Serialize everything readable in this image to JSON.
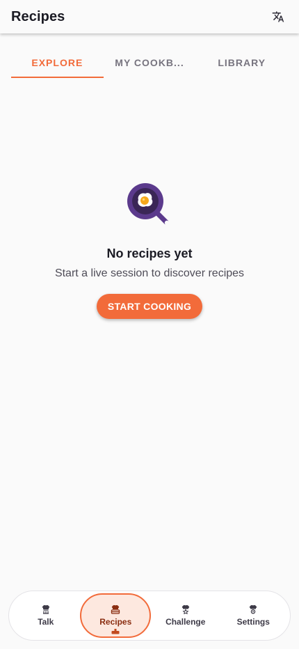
{
  "header": {
    "title": "Recipes",
    "translate_icon": "translate-icon"
  },
  "tabs": [
    {
      "label": "EXPLORE",
      "active": true
    },
    {
      "label": "MY COOKB...",
      "active": false
    },
    {
      "label": "LIBRARY",
      "active": false
    }
  ],
  "empty_state": {
    "icon": "frying-pan-egg-icon",
    "title": "No recipes yet",
    "subtitle": "Start a live session to discover recipes",
    "button_label": "START COOKING"
  },
  "bottom_nav": {
    "items": [
      {
        "label": "Talk",
        "icon": "talk-chef-icon",
        "active": false
      },
      {
        "label": "Recipes",
        "icon": "recipes-chef-icon",
        "active": true
      },
      {
        "label": "Challenge",
        "icon": "challenge-chef-icon",
        "active": false
      },
      {
        "label": "Settings",
        "icon": "settings-chef-icon",
        "active": false
      }
    ]
  },
  "colors": {
    "accent": "#f26b3a",
    "pan": "#5b3a8c",
    "background": "#fafafa",
    "nav_active_bg": "#fde8df"
  }
}
